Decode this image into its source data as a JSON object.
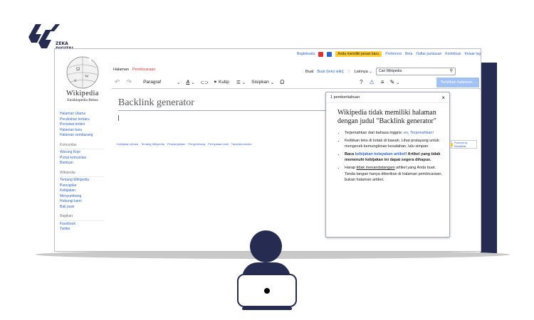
{
  "brand": {
    "line1": "ZEKA",
    "line2": "DIGITAL"
  },
  "topbar": {
    "user": "Bogteleada",
    "alert": "Anda memiliki pesan baru.",
    "links": [
      "Preferensi",
      "Beta",
      "Daftar pantauan",
      "Kontribusi",
      "Keluar log"
    ]
  },
  "wiki": {
    "wordmark": "Wikipedia",
    "tagline": "Ensiklopedia Bebas"
  },
  "sidebar": {
    "main": [
      "Halaman Utama",
      "Perubahan terbaru",
      "Peristiwa terkini",
      "Halaman baru",
      "Halaman sembarang"
    ],
    "community_heading": "Komunitas",
    "community": [
      "Warung Kopi",
      "Portal komunitas",
      "Bantuan"
    ],
    "wikipedia_heading": "Wikipedia",
    "wikipedia": [
      "Tentang Wikipedia",
      "Pancapilar",
      "Kebijakan",
      "Menyumbang",
      "Hubungi kami",
      "Bak pasir"
    ],
    "share_heading": "Bagikan",
    "share": [
      "Facebook",
      "Twitter"
    ]
  },
  "tabs": {
    "page": "Halaman",
    "talk": "Pembicaraan",
    "create": "Buat",
    "create_source": "Buat (teks wiki)",
    "more": "Lainnya",
    "search_placeholder": "Cari Wikipedia"
  },
  "toolbar": {
    "format": "Paragraf",
    "cite": "Kutip",
    "insert": "Sisipkan",
    "save": "Terbitkan halaman..."
  },
  "page": {
    "title": "Backlink generator"
  },
  "footer": [
    "Kebijakan privasi",
    "Tentang Wikipedia",
    "Penyangkalan",
    "Pengembang",
    "Pernyataan kuki",
    "Tampilan seluler"
  ],
  "mw_badge": "Powered by MediaWiki",
  "notice": {
    "header": "1 pemberitahuan",
    "title": "Wikipedia tidak memiliki halaman dengan judul \"Backlink generator\"",
    "item1_text": "Terjemahkan dari bahasa Inggris: ",
    "item1_link1": "en",
    "item1_link2": "Terjemahkan!",
    "item2": "Ketikkan teks di kotak di bawah. Lihat pratayang untuk mengecek kemungkinan kesalahan, lalu simpan.",
    "item3_pre": "Baca ",
    "item3_link": "kebijakan kelayakan artikel",
    "item3_post": "! Artikel yang tidak memenuhi kebijakan ini dapat segera dihapus.",
    "item4_pre": "Harap ",
    "item4_link": "tidak menandatangani",
    "item4_post": " artikel yang Anda buat. Tanda tangan hanya diberikan di halaman pembicaraan, bukan halaman artikel."
  }
}
